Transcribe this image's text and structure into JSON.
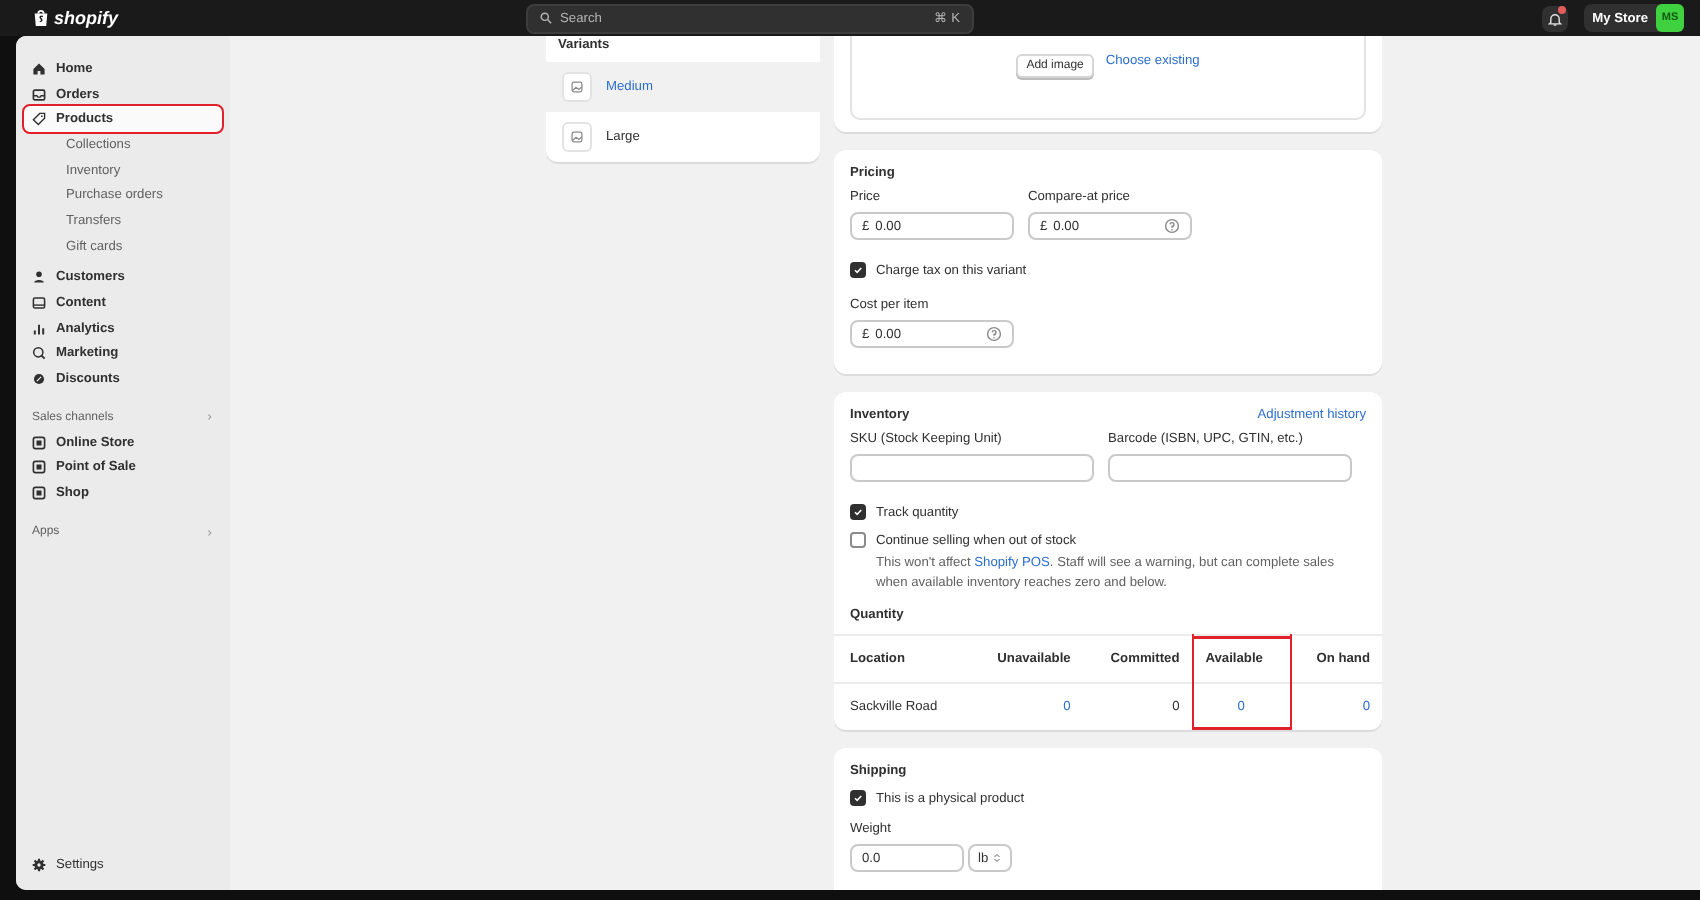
{
  "topbar": {
    "logo": "shopify",
    "search": {
      "placeholder": "Search",
      "shortcut": "⌘ K"
    },
    "notifications_unread": true,
    "store": "My Store",
    "avatar": "MS"
  },
  "sidebar": {
    "items": [
      {
        "label": "Home",
        "selected": false,
        "highlighted": false
      },
      {
        "label": "Orders",
        "selected": false,
        "highlighted": false
      },
      {
        "label": "Products",
        "selected": true,
        "highlighted": true,
        "children": [
          {
            "label": "Collections"
          },
          {
            "label": "Inventory"
          },
          {
            "label": "Purchase orders"
          },
          {
            "label": "Transfers"
          },
          {
            "label": "Gift cards"
          }
        ]
      },
      {
        "label": "Customers",
        "selected": false,
        "highlighted": false
      },
      {
        "label": "Content",
        "selected": false,
        "highlighted": false
      },
      {
        "label": "Analytics",
        "selected": false,
        "highlighted": false
      },
      {
        "label": "Marketing",
        "selected": false,
        "highlighted": false
      },
      {
        "label": "Discounts",
        "selected": false,
        "highlighted": false
      }
    ],
    "sections": [
      {
        "title": "Sales channels",
        "items": [
          {
            "label": "Online Store"
          },
          {
            "label": "Point of Sale"
          },
          {
            "label": "Shop"
          }
        ]
      },
      {
        "title": "Apps"
      }
    ],
    "settings": "Settings"
  },
  "variants": {
    "title": "Variants",
    "items": [
      {
        "label": "Medium",
        "selected": true
      },
      {
        "label": "Large",
        "selected": false
      }
    ]
  },
  "media": {
    "button": "Add image",
    "link": "Choose existing"
  },
  "pricing": {
    "title": "Pricing",
    "fields": [
      {
        "label": "Price",
        "prefix": "£",
        "value": "0.00",
        "help": false
      },
      {
        "label": "Compare-at price",
        "prefix": "£",
        "value": "0.00",
        "help": true
      }
    ],
    "checkbox": {
      "label": "Charge tax on this variant",
      "checked": true
    },
    "cost": {
      "label": "Cost per item",
      "prefix": "£",
      "value": "0.00",
      "help": true
    }
  },
  "inventory": {
    "title": "Inventory",
    "link": "Adjustment history",
    "fields": [
      {
        "label": "SKU (Stock Keeping Unit)"
      },
      {
        "label": "Barcode (ISBN, UPC, GTIN, etc.)"
      }
    ],
    "checkboxes": [
      {
        "label": "Track quantity",
        "checked": true
      },
      {
        "label": "Continue selling when out of stock",
        "checked": false,
        "note": {
          "before": "This won't affect ",
          "link": "Shopify POS",
          "after": ". Staff will see a warning, but can complete sales when available inventory reaches zero and below."
        }
      }
    ],
    "quantity": {
      "title": "Quantity",
      "columns": [
        {
          "label": "Location",
          "highlighted": false
        },
        {
          "label": "Unavailable",
          "highlighted": false
        },
        {
          "label": "Committed",
          "highlighted": false
        },
        {
          "label": "Available",
          "highlighted": true
        },
        {
          "label": "On hand",
          "highlighted": false
        }
      ],
      "rows": [
        [
          {
            "text": "Sackville Road",
            "kind": "plain"
          },
          {
            "text": "0",
            "kind": "link"
          },
          {
            "text": "0",
            "kind": "plain"
          },
          {
            "text": "0",
            "kind": "link"
          },
          {
            "text": "0",
            "kind": "link"
          }
        ]
      ]
    }
  },
  "shipping": {
    "title": "Shipping",
    "checkbox": {
      "label": "This is a physical product",
      "checked": true
    },
    "weight": {
      "label": "Weight",
      "value": "0.0",
      "unit": "lb"
    }
  }
}
